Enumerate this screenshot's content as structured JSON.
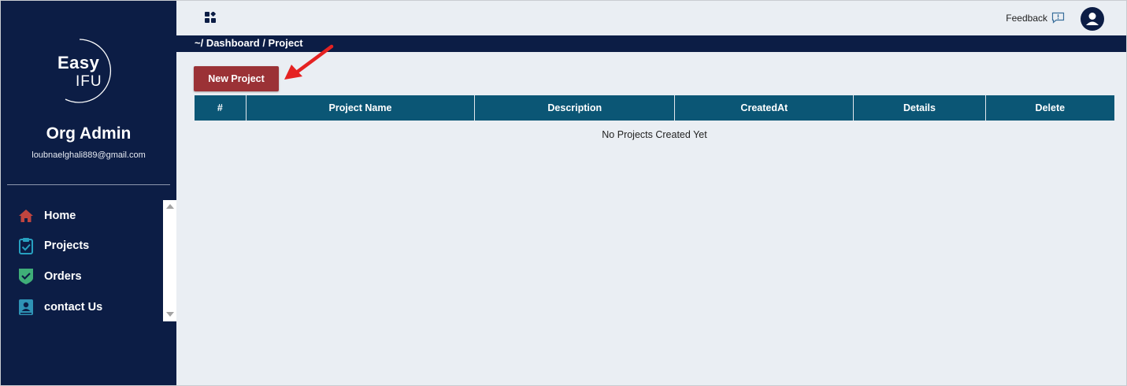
{
  "sidebar": {
    "logo": {
      "line1": "Easy",
      "line2": "IFU"
    },
    "org_name": "Org Admin",
    "email": "loubnaelghali889@gmail.com",
    "items": [
      {
        "label": "Home",
        "icon": "home-icon",
        "color": "#c0453f"
      },
      {
        "label": "Projects",
        "icon": "clipboard-check-icon",
        "color": "#27a0c0"
      },
      {
        "label": "Orders",
        "icon": "shield-check-icon",
        "color": "#3fae78"
      },
      {
        "label": "contact Us",
        "icon": "contact-card-icon",
        "color": "#2f93b5"
      }
    ]
  },
  "topbar": {
    "apps_icon": "grid-icon",
    "feedback_label": "Feedback",
    "feedback_icon": "message-alert-icon",
    "avatar_icon": "user-icon"
  },
  "breadcrumb": "~/ Dashboard / Project",
  "main": {
    "new_project_label": "New Project",
    "table": {
      "headers": [
        "#",
        "Project Name",
        "Description",
        "CreatedAt",
        "Details",
        "Delete"
      ],
      "empty_message": "No Projects Created Yet"
    }
  },
  "colors": {
    "sidebar_bg": "#0c1d45",
    "table_header_bg": "#0b5675",
    "primary_button": "#9b3236",
    "annotation_arrow": "#e52222"
  }
}
